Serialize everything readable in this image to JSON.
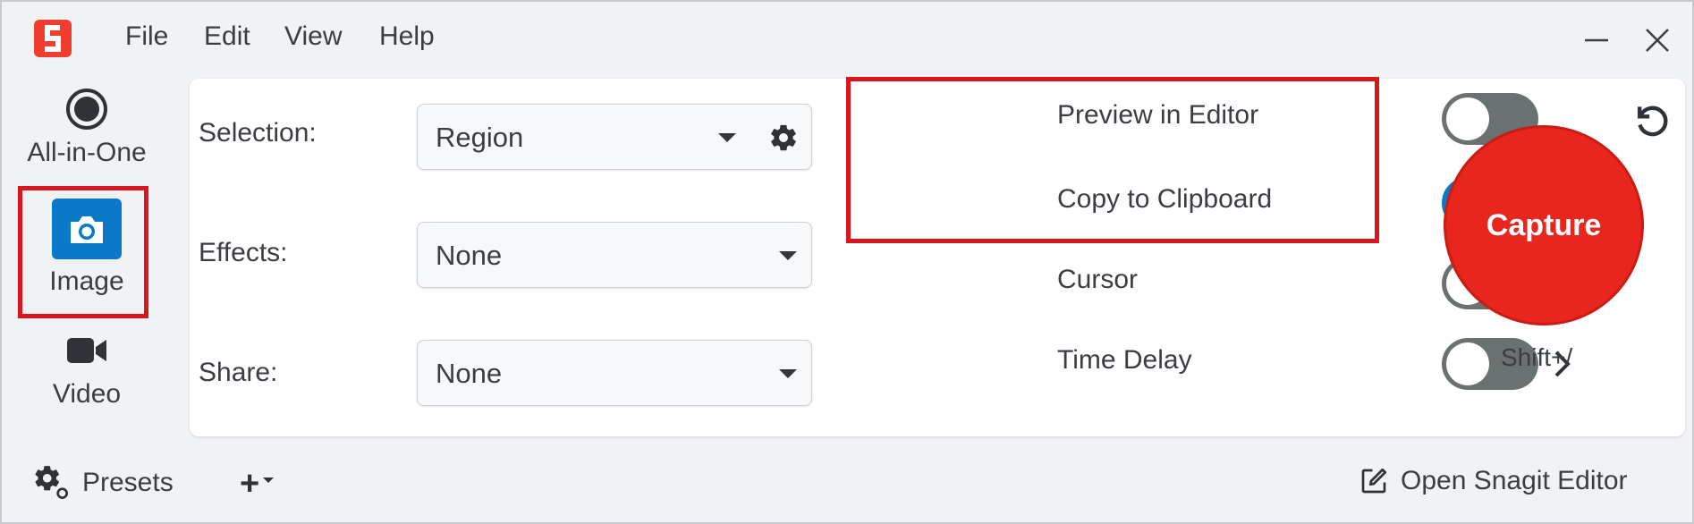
{
  "menu": [
    "File",
    "Edit",
    "View",
    "Help"
  ],
  "rail": {
    "all_in_one": "All-in-One",
    "image": "Image",
    "video": "Video"
  },
  "fields": {
    "selection_label": "Selection:",
    "selection_value": "Region",
    "effects_label": "Effects:",
    "effects_value": "None",
    "share_label": "Share:",
    "share_value": "None"
  },
  "toggles": [
    {
      "label": "Preview in Editor",
      "on": false
    },
    {
      "label": "Copy to Clipboard",
      "on": true
    },
    {
      "label": "Cursor",
      "on": false
    },
    {
      "label": "Time Delay",
      "on": false
    }
  ],
  "capture": {
    "label": "Capture",
    "shortcut": "Shift+/"
  },
  "footer": {
    "presets": "Presets",
    "add": "+",
    "open_editor": "Open Snagit Editor"
  },
  "colors": {
    "accent_blue": "#0b78c8",
    "capture_red": "#e8261d",
    "highlight_red": "#d9161d",
    "logo_red": "#ef3e30"
  }
}
